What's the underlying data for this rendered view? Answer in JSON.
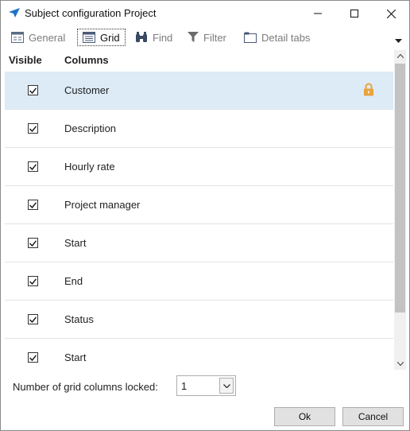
{
  "window": {
    "title": "Subject configuration Project"
  },
  "tabs": [
    {
      "label": "General",
      "icon": "general-icon"
    },
    {
      "label": "Grid",
      "icon": "grid-icon",
      "active": true
    },
    {
      "label": "Find",
      "icon": "binoculars-icon"
    },
    {
      "label": "Filter",
      "icon": "filter-icon"
    },
    {
      "label": "Detail tabs",
      "icon": "detail-tabs-icon"
    }
  ],
  "grid": {
    "headers": {
      "visible": "Visible",
      "columns": "Columns"
    },
    "rows": [
      {
        "checked": true,
        "label": "Customer",
        "selected": true,
        "locked": true
      },
      {
        "checked": true,
        "label": "Description"
      },
      {
        "checked": true,
        "label": "Hourly rate"
      },
      {
        "checked": true,
        "label": "Project manager"
      },
      {
        "checked": true,
        "label": "Start"
      },
      {
        "checked": true,
        "label": "End"
      },
      {
        "checked": true,
        "label": "Status"
      },
      {
        "checked": true,
        "label": "Start"
      }
    ]
  },
  "locked_columns": {
    "label": "Number of grid columns locked:",
    "value": "1"
  },
  "buttons": {
    "ok": "Ok",
    "cancel": "Cancel"
  },
  "colors": {
    "selected_row": "#dcebf6",
    "lock": "#e8a33d",
    "accent": "#1e73c8"
  }
}
